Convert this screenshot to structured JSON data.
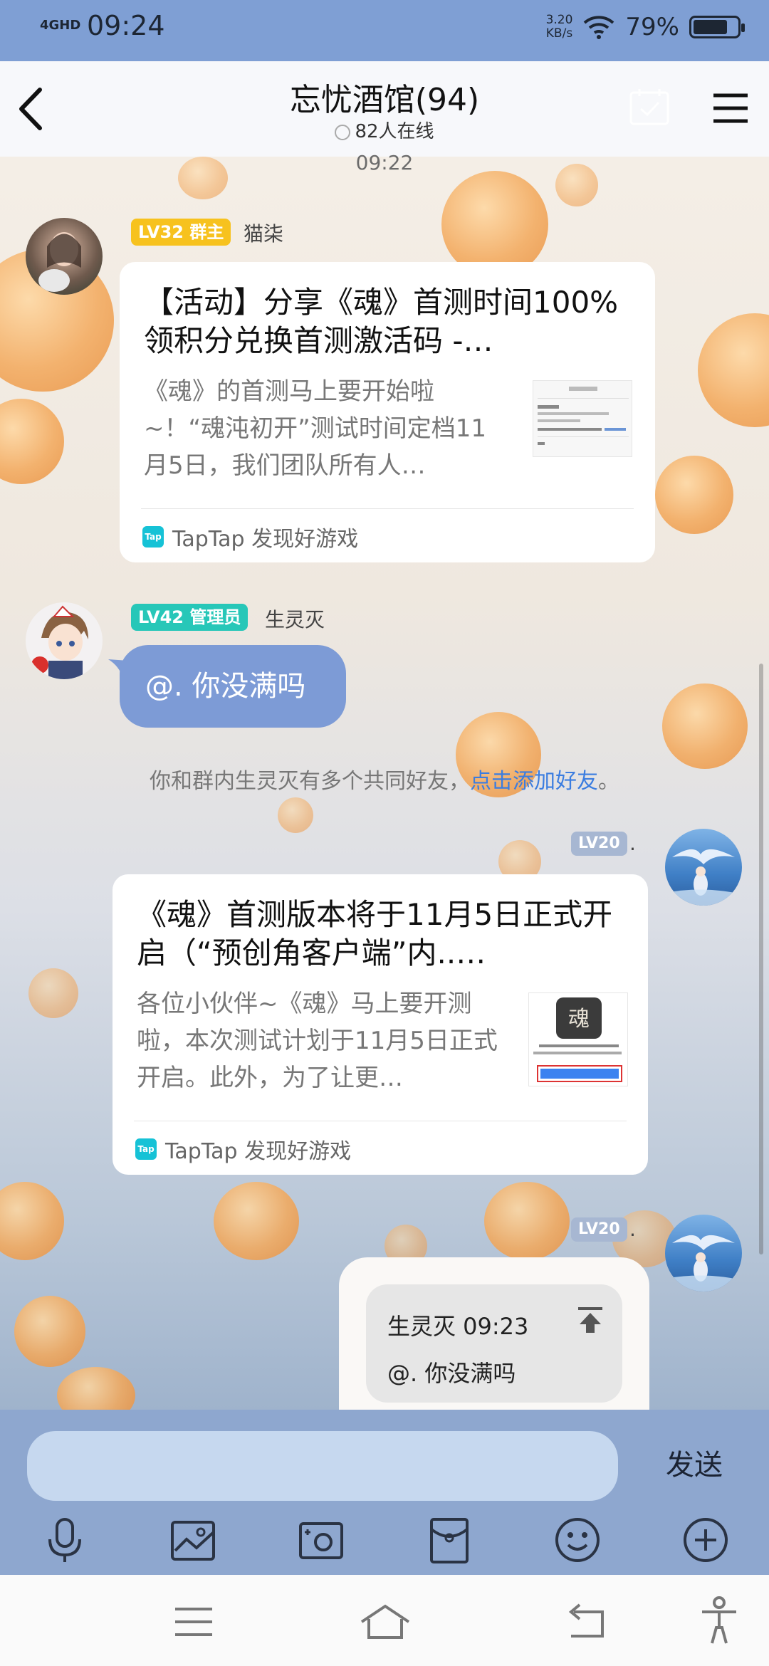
{
  "status_bar": {
    "network": "4GHD",
    "time": "09:24",
    "speed_value": "3.20",
    "speed_unit": "KB/s",
    "battery_percent": "79%",
    "battery_level": 0.79
  },
  "header": {
    "title": "忘忧酒馆(94)",
    "online": "82人在线"
  },
  "chat": {
    "timestamp": "09:22",
    "msg1": {
      "badge_level": "LV32",
      "badge_role": "群主",
      "nickname": "猫柒",
      "card_title": "【活动】分享《魂》首测时间100%领积分兑换首测激活码 -…",
      "card_desc": "《魂》的首测马上要开始啦~！“魂沌初开”测试时间定档11月5日，我们团队所有人…",
      "source": "TapTap 发现好游戏",
      "source_logo": "Tap"
    },
    "msg2": {
      "badge_level": "LV42",
      "badge_role": "管理员",
      "nickname": "生灵灭",
      "text": "@. 你没满吗"
    },
    "system_note": {
      "text": "你和群内生灵灭有多个共同好友，",
      "link": "点击添加好友",
      "suffix": "。"
    },
    "msg3": {
      "badge_level": "LV20",
      "nickname": ".",
      "card_title": "《魂》首测版本将于11月5日正式开启（“预创角客户端”内..…",
      "card_desc": "各位小伙伴~《魂》马上要开测啦，本次测试计划于11月5日正式开启。此外，为了让更…",
      "source": "TapTap 发现好游戏",
      "source_logo": "Tap"
    },
    "msg4": {
      "badge_level": "LV20",
      "nickname": ".",
      "quote_author_time": "生灵灭 09:23",
      "quote_text": "@. 你没满吗"
    }
  },
  "input": {
    "placeholder": "",
    "send_label": "发送"
  },
  "colors": {
    "status_bar": "#7f9fd4",
    "accent_blue": "#7d9bd6",
    "badge_owner": "#f7c21e",
    "badge_admin": "#27c7b8",
    "badge_level": "#a7b7d2",
    "link": "#3b7de0"
  },
  "icons": [
    "back-icon",
    "calendar-check-icon",
    "menu-icon",
    "mic-icon",
    "image-icon",
    "camera-icon",
    "red-packet-icon",
    "emoji-icon",
    "plus-icon",
    "nav-menu-icon",
    "nav-home-icon",
    "nav-back-icon",
    "accessibility-icon",
    "pin-top-icon"
  ]
}
